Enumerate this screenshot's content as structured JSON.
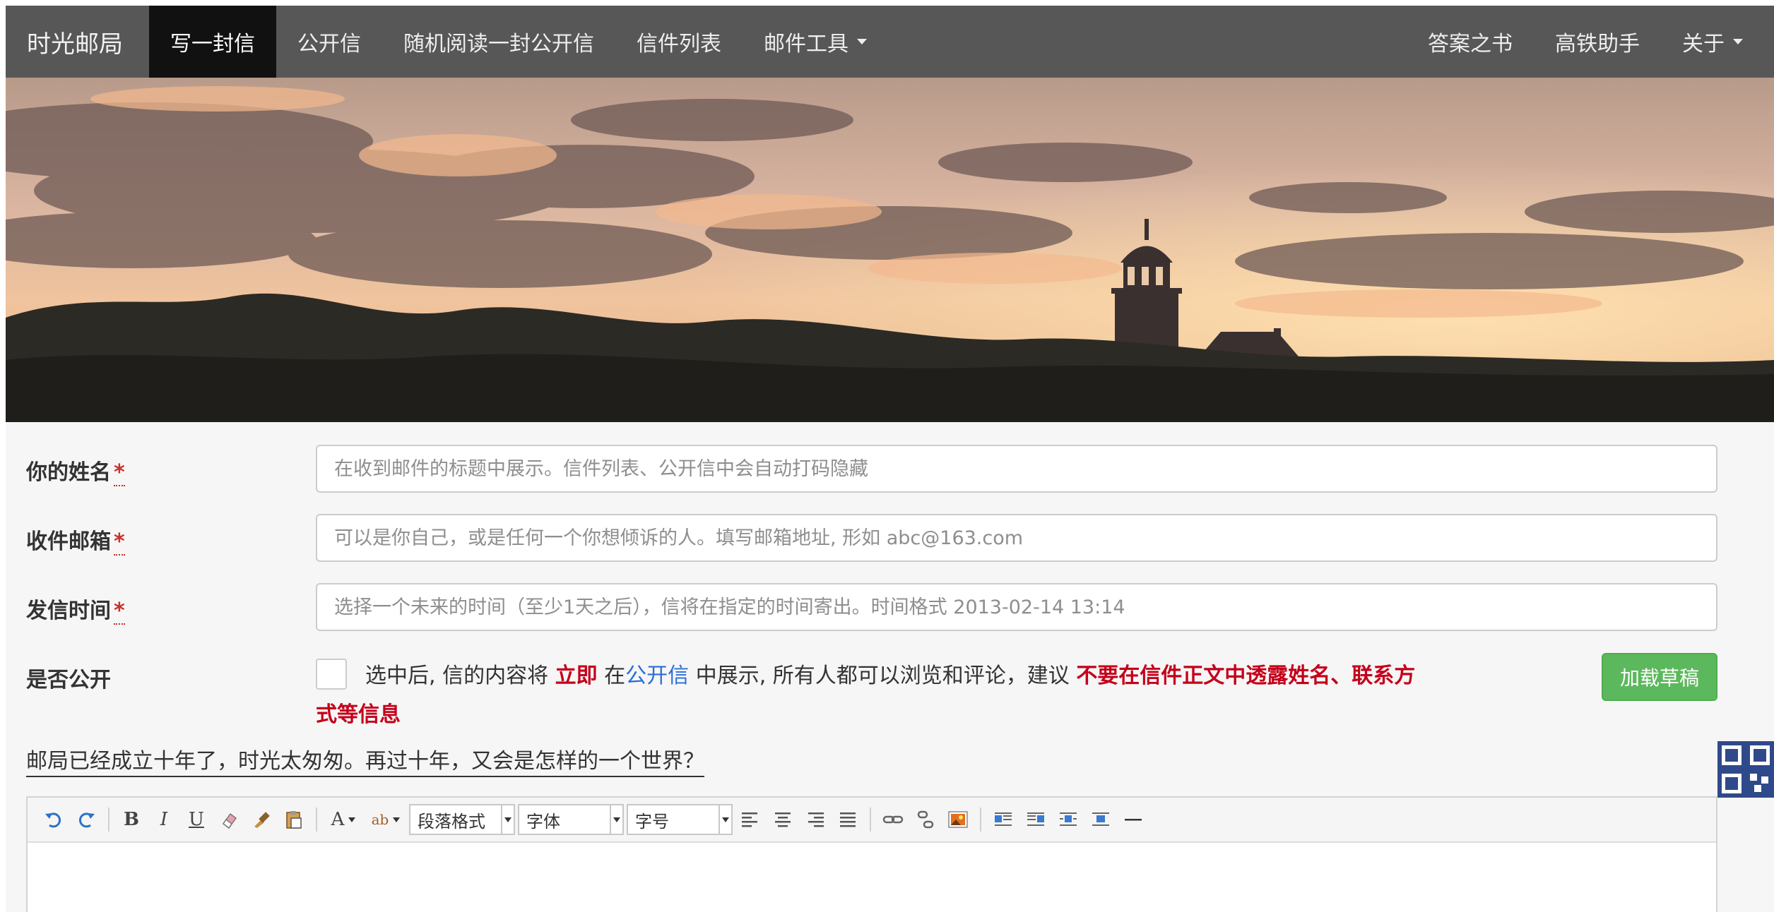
{
  "nav": {
    "brand": "时光邮局",
    "items": [
      {
        "label": "写一封信",
        "active": true
      },
      {
        "label": "公开信"
      },
      {
        "label": "随机阅读一封公开信"
      },
      {
        "label": "信件列表"
      },
      {
        "label": "邮件工具"
      }
    ],
    "right_items": [
      {
        "label": "答案之书"
      },
      {
        "label": "高铁助手"
      },
      {
        "label": "关于"
      }
    ]
  },
  "form": {
    "name": {
      "label": "你的姓名",
      "required_mark": "*",
      "placeholder": "在收到邮件的标题中展示。信件列表、公开信中会自动打码隐藏"
    },
    "email": {
      "label": "收件邮箱",
      "required_mark": "*",
      "placeholder": "可以是你自己，或是任何一个你想倾诉的人。填写邮箱地址, 形如 abc@163.com"
    },
    "time": {
      "label": "发信时间",
      "required_mark": "*",
      "placeholder": "选择一个未来的时间（至少1天之后），信将在指定的时间寄出。时间格式 2013-02-14 13:14"
    },
    "public": {
      "label": "是否公开",
      "text_1": "选中后, 信的内容将 ",
      "text_immediate": "立即",
      "text_2": " 在",
      "link": "公开信",
      "text_3": " 中展示, 所有人都可以浏览和评论，建议 ",
      "warning": "不要在信件正文中透露姓名、联系方式等信息"
    },
    "draft_button": "加载草稿"
  },
  "motto": "邮局已经成立十年了，时光太匆匆。再过十年，又会是怎样的一个世界？",
  "editor": {
    "paragraph_select": "段落格式",
    "font_select": "字体",
    "size_select": "字号"
  },
  "colors": {
    "navbar": "#575757",
    "active_nav": "#111111",
    "success": "#5cb85c",
    "warning_red": "#c4001a",
    "link_blue": "#2a6fd8"
  }
}
